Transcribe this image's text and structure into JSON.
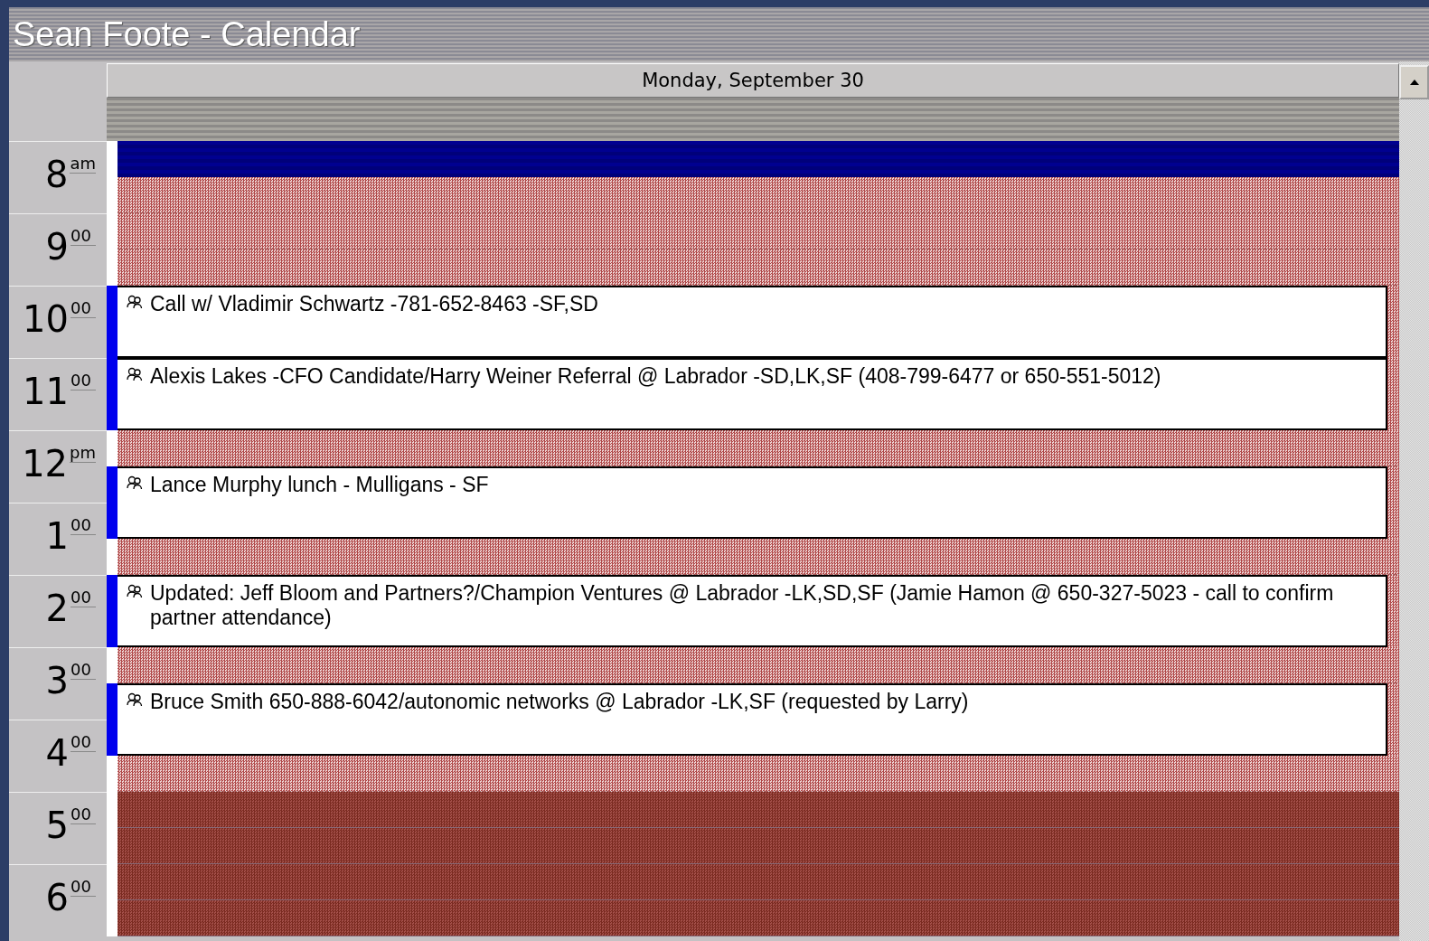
{
  "window": {
    "title": "Sean Foote - Calendar"
  },
  "day_header": "Monday, September 30",
  "hours": [
    {
      "hour": "8",
      "suffix": "am"
    },
    {
      "hour": "9",
      "suffix": "00"
    },
    {
      "hour": "10",
      "suffix": "00"
    },
    {
      "hour": "11",
      "suffix": "00"
    },
    {
      "hour": "12",
      "suffix": "pm"
    },
    {
      "hour": "1",
      "suffix": "00"
    },
    {
      "hour": "2",
      "suffix": "00"
    },
    {
      "hour": "3",
      "suffix": "00"
    },
    {
      "hour": "4",
      "suffix": "00"
    },
    {
      "hour": "5",
      "suffix": "00"
    },
    {
      "hour": "6",
      "suffix": "00"
    }
  ],
  "slots": [
    {
      "kind": "selected"
    },
    {
      "kind": "free"
    },
    {
      "kind": "free"
    },
    {
      "kind": "free"
    },
    {
      "kind": "event",
      "subject": "Call w/ Vladimir Schwartz -781-652-8463 -SF,SD"
    },
    {
      "kind": "event_continued"
    },
    {
      "kind": "event",
      "subject": "Alexis Lakes -CFO Candidate/Harry Weiner Referral @ Labrador -SD,LK,SF (408-799-6477 or 650-551-5012)"
    },
    {
      "kind": "event_continued"
    },
    {
      "kind": "free"
    },
    {
      "kind": "event",
      "subject": "Lance Murphy lunch - Mulligans - SF"
    },
    {
      "kind": "event_continued"
    },
    {
      "kind": "free"
    },
    {
      "kind": "event",
      "subject": "Updated: Jeff Bloom and Partners?/Champion Ventures @ Labrador -LK,SD,SF (Jamie Hamon @ 650-327-5023 - call to confirm partner attendance)"
    },
    {
      "kind": "event_continued"
    },
    {
      "kind": "free"
    },
    {
      "kind": "event",
      "subject": "Bruce Smith 650-888-6042/autonomic networks @ Labrador -LK,SF (requested by Larry)"
    },
    {
      "kind": "event_continued"
    },
    {
      "kind": "free"
    },
    {
      "kind": "off_hours"
    },
    {
      "kind": "off_hours"
    },
    {
      "kind": "off_hours"
    },
    {
      "kind": "off_hours"
    }
  ]
}
